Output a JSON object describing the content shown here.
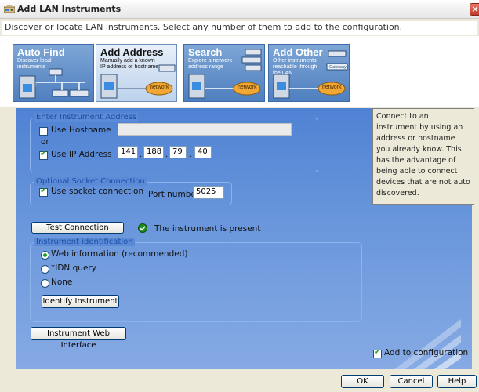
{
  "window": {
    "title": "Add LAN Instruments",
    "close_glyph": "×",
    "description": "Discover or locate LAN instruments. Select any number of them to add to the configuration."
  },
  "tabs": [
    {
      "title": "Auto Find",
      "subtitle": "Discover local instruments",
      "active": false
    },
    {
      "title": "Add Address",
      "subtitle": "Manually add a known IP address or hostname",
      "active": true,
      "badge": "network"
    },
    {
      "title": "Search",
      "subtitle": "Explore a network address range",
      "active": false,
      "badge": "network"
    },
    {
      "title": "Add Other",
      "subtitle": "Other instruments reachable through the LAN",
      "active": false,
      "badge": "network",
      "gateway": "Gateway"
    }
  ],
  "info_text": "Connect to an instrument by using an address or hostname you already know. This has the advantage of being able to connect devices that are not auto discovered.",
  "address_group": {
    "legend": "Enter Instrument Address",
    "use_hostname_label": "Use Hostname",
    "use_hostname_checked": false,
    "hostname_value": "",
    "or_label": "or",
    "use_ip_label": "Use IP Address",
    "use_ip_checked": true,
    "ip_octets": [
      "141",
      "188",
      "79",
      "40"
    ],
    "separator": "."
  },
  "socket_group": {
    "legend": "Optional Socket Connection",
    "use_socket_label": "Use socket connection",
    "use_socket_checked": true,
    "port_label": "Port number:",
    "port_value": "5025"
  },
  "test_connection": {
    "button_label": "Test Connection",
    "status_text": "The instrument is present",
    "status_color": "#21a121"
  },
  "identification_group": {
    "legend": "Instrument identification",
    "options": [
      {
        "label": "Web information (recommended)",
        "selected": true
      },
      {
        "label": "*IDN query",
        "selected": false
      },
      {
        "label": "None",
        "selected": false
      }
    ],
    "identify_button_label": "Identify Instrument"
  },
  "web_interface_button_label": "Instrument Web Interface",
  "add_to_configuration": {
    "label": "Add to configuration",
    "checked": true
  },
  "footer": {
    "ok_label": "OK",
    "cancel_label": "Cancel",
    "help_label": "Help"
  },
  "colors": {
    "panel_top": "#4f82d4",
    "panel_bottom": "#86aae4",
    "legend_text": "#1b4ea8",
    "tab_blue": "#4f7fbf"
  }
}
